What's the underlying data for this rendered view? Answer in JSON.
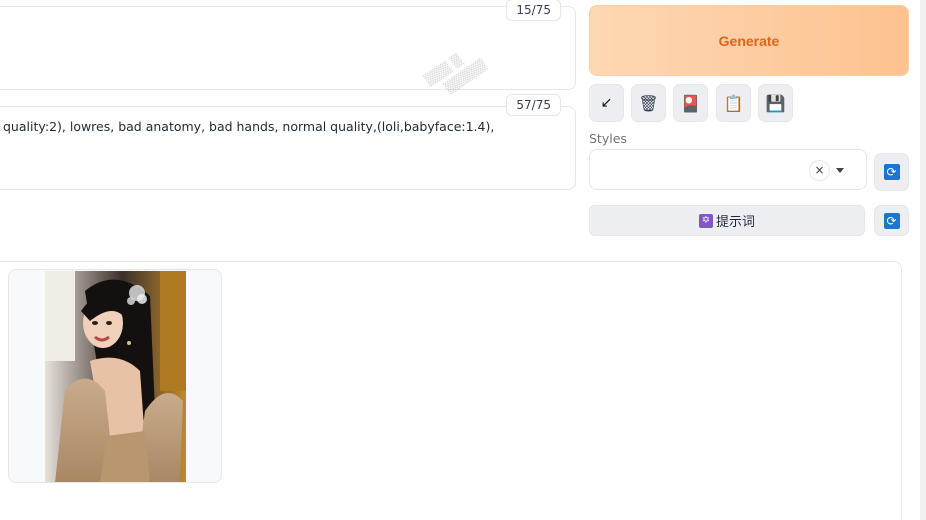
{
  "prompt": {
    "positive_token_count": "15/75",
    "negative_text": "quality:2), lowres, bad anatomy, bad hands, normal quality,(loli,babyface:1.4),",
    "negative_token_count": "57/75"
  },
  "actions": {
    "generate_label": "Generate",
    "tools": [
      {
        "icon": "arrow-icon",
        "glyph": "↙"
      },
      {
        "icon": "trash-icon",
        "glyph": "🗑"
      },
      {
        "icon": "picture-icon",
        "glyph": "🎴"
      },
      {
        "icon": "clipboard-icon",
        "glyph": "📋"
      },
      {
        "icon": "save-icon",
        "glyph": "💾"
      }
    ]
  },
  "styles": {
    "label": "Styles",
    "clear_glyph": "×",
    "refresh_glyph": "🔄"
  },
  "prompt_words_button": {
    "icon_glyph": "✡",
    "label": "提示词"
  },
  "colors": {
    "generate_text": "#e0651a",
    "generate_bg_start": "#fdd8b4",
    "generate_bg_end": "#fdc290",
    "refresh_icon_bg": "#1976d2"
  }
}
